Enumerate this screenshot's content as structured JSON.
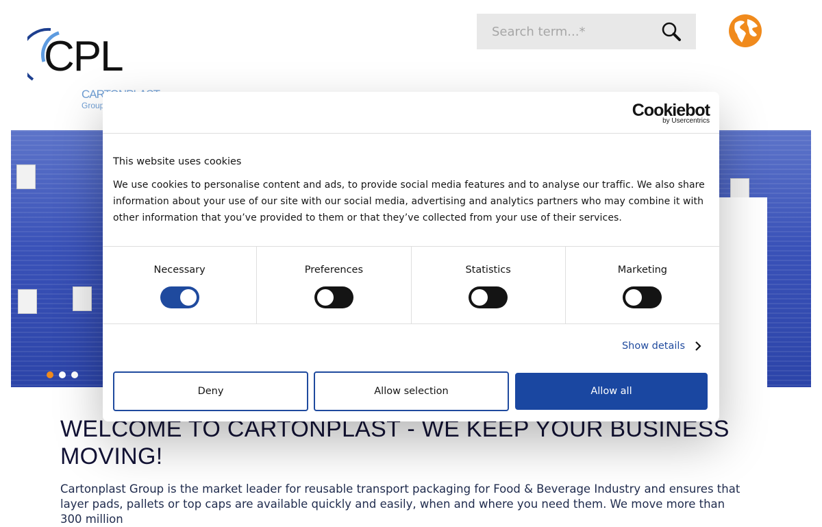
{
  "header": {
    "logo": {
      "text": "CPL",
      "sub_line1": "CARTONPLAST",
      "sub_line2": "Group"
    },
    "search": {
      "placeholder": "Search term...*",
      "icon": "search-icon"
    },
    "language_icon": "globe-icon",
    "accent_color": "#f08a1c"
  },
  "hero": {
    "slides": 3,
    "active_slide": 1,
    "dot_active_color": "#f08a1c"
  },
  "main": {
    "heading": "WELCOME TO CARTONPLAST - WE KEEP YOUR BUSINESS MOVING!",
    "intro": "Cartonplast Group is the market leader for reusable transport packaging for Food & Beverage Industry and ensures that layer pads, pallets or top caps are available quickly and easily, when and where you need them. We move more than 300 million"
  },
  "cookie_dialog": {
    "brand": "Cookiebot",
    "brand_sub": "by Usercentrics",
    "title": "This website uses cookies",
    "text": "We use cookies to personalise content and ads, to provide social media features and to analyse our traffic. We also share information about your use of our site with our social media, advertising and analytics partners who may combine it with other information that you’ve provided to them or that they’ve collected from your use of their services.",
    "categories": [
      {
        "label": "Necessary",
        "enabled": true
      },
      {
        "label": "Preferences",
        "enabled": false
      },
      {
        "label": "Statistics",
        "enabled": false
      },
      {
        "label": "Marketing",
        "enabled": false
      }
    ],
    "show_details": "Show details",
    "buttons": {
      "deny": "Deny",
      "allow_selection": "Allow selection",
      "allow_all": "Allow all"
    },
    "primary_color": "#1a47a1"
  }
}
